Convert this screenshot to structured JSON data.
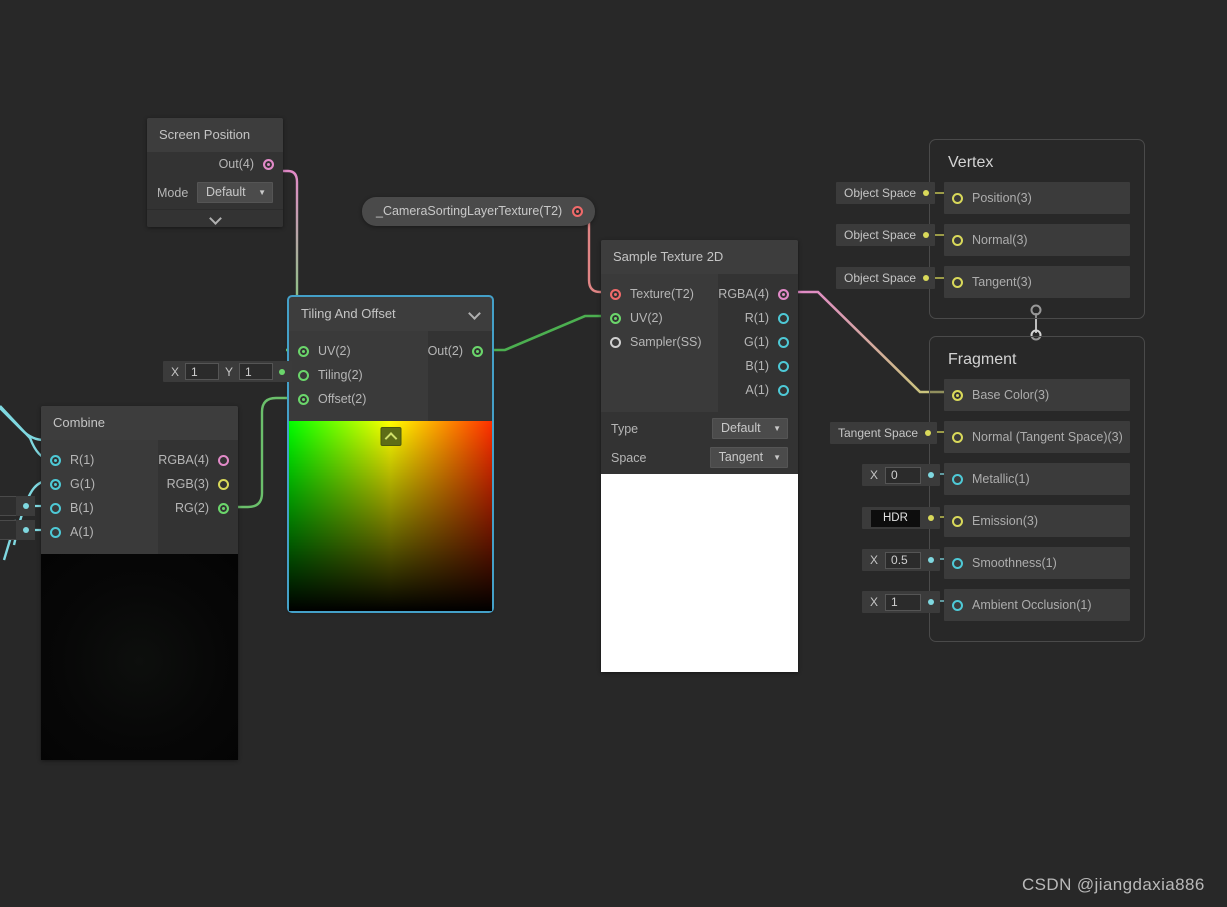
{
  "app": {
    "background": "#282828",
    "watermark": "CSDN @jiangdaxia886"
  },
  "nodes": {
    "screen_position": {
      "title": "Screen Position",
      "outputs": [
        {
          "label": "Out(4)",
          "type": "pink",
          "connected": true
        }
      ],
      "properties": [
        {
          "label": "Mode",
          "value": "Default"
        }
      ],
      "expander_icon": "chevron-down-icon"
    },
    "texture_property": {
      "label": "_CameraSortingLayerTexture(T2)",
      "port_type": "red",
      "connected": true
    },
    "tiling_and_offset": {
      "title": "Tiling And Offset",
      "selected": true,
      "collapse_icon": "chevron-down-icon",
      "inputs": [
        {
          "label": "UV(2)",
          "type": "green",
          "connected": true
        },
        {
          "label": "Tiling(2)",
          "type": "green",
          "connected": false
        },
        {
          "label": "Offset(2)",
          "type": "green",
          "connected": true
        }
      ],
      "outputs": [
        {
          "label": "Out(2)",
          "type": "green",
          "connected": true
        }
      ],
      "tiling_widget": {
        "x_label": "X",
        "x_value": "1",
        "y_label": "Y",
        "y_value": "1"
      },
      "preview": "uv-gradient"
    },
    "sample_texture_2d": {
      "title": "Sample Texture 2D",
      "inputs": [
        {
          "label": "Texture(T2)",
          "type": "red",
          "connected": true
        },
        {
          "label": "UV(2)",
          "type": "green",
          "connected": true
        },
        {
          "label": "Sampler(SS)",
          "type": "white",
          "connected": false
        }
      ],
      "outputs": [
        {
          "label": "RGBA(4)",
          "type": "pink",
          "connected": true
        },
        {
          "label": "R(1)",
          "type": "cyan",
          "connected": false
        },
        {
          "label": "G(1)",
          "type": "cyan",
          "connected": false
        },
        {
          "label": "B(1)",
          "type": "cyan",
          "connected": false
        },
        {
          "label": "A(1)",
          "type": "cyan",
          "connected": false
        }
      ],
      "properties": [
        {
          "label": "Type",
          "value": "Default"
        },
        {
          "label": "Space",
          "value": "Tangent"
        }
      ],
      "preview": "white"
    },
    "combine": {
      "title": "Combine",
      "inputs": [
        {
          "label": "R(1)",
          "type": "cyan",
          "connected": true
        },
        {
          "label": "G(1)",
          "type": "cyan",
          "connected": true
        },
        {
          "label": "B(1)",
          "type": "cyan",
          "connected": false
        },
        {
          "label": "A(1)",
          "type": "cyan",
          "connected": false
        }
      ],
      "outputs": [
        {
          "label": "RGBA(4)",
          "type": "pink",
          "connected": false
        },
        {
          "label": "RGB(3)",
          "type": "yellow",
          "connected": false
        },
        {
          "label": "RG(2)",
          "type": "green",
          "connected": true
        }
      ],
      "preview": "black"
    }
  },
  "stacks": {
    "vertex": {
      "title": "Vertex",
      "rows": [
        {
          "label": "Position(3)",
          "type": "yellow",
          "connected": false,
          "value_widget": {
            "kind": "space",
            "text": "Object Space"
          }
        },
        {
          "label": "Normal(3)",
          "type": "yellow",
          "connected": false,
          "value_widget": {
            "kind": "space",
            "text": "Object Space"
          }
        },
        {
          "label": "Tangent(3)",
          "type": "yellow",
          "connected": false,
          "value_widget": {
            "kind": "space",
            "text": "Object Space"
          }
        }
      ]
    },
    "fragment": {
      "title": "Fragment",
      "rows": [
        {
          "label": "Base Color(3)",
          "type": "yellow",
          "connected": true,
          "value_widget": null
        },
        {
          "label": "Normal (Tangent Space)(3)",
          "type": "yellow",
          "connected": false,
          "value_widget": {
            "kind": "space",
            "text": "Tangent Space"
          }
        },
        {
          "label": "Metallic(1)",
          "type": "cyan",
          "connected": false,
          "value_widget": {
            "kind": "number",
            "lead": "X",
            "value": "0"
          }
        },
        {
          "label": "Emission(3)",
          "type": "yellow",
          "connected": false,
          "value_widget": {
            "kind": "hdr",
            "text": "HDR"
          }
        },
        {
          "label": "Smoothness(1)",
          "type": "cyan",
          "connected": false,
          "value_widget": {
            "kind": "number",
            "lead": "X",
            "value": "0.5"
          }
        },
        {
          "label": "Ambient Occlusion(1)",
          "type": "cyan",
          "connected": false,
          "value_widget": {
            "kind": "number",
            "lead": "X",
            "value": "1"
          }
        }
      ]
    }
  },
  "wire_colors": {
    "vector4": "#e28ac8",
    "vector2": "#6bd66b",
    "texture": "#e08585",
    "float": "#7fd8e0",
    "vector3": "#d9d95a"
  }
}
